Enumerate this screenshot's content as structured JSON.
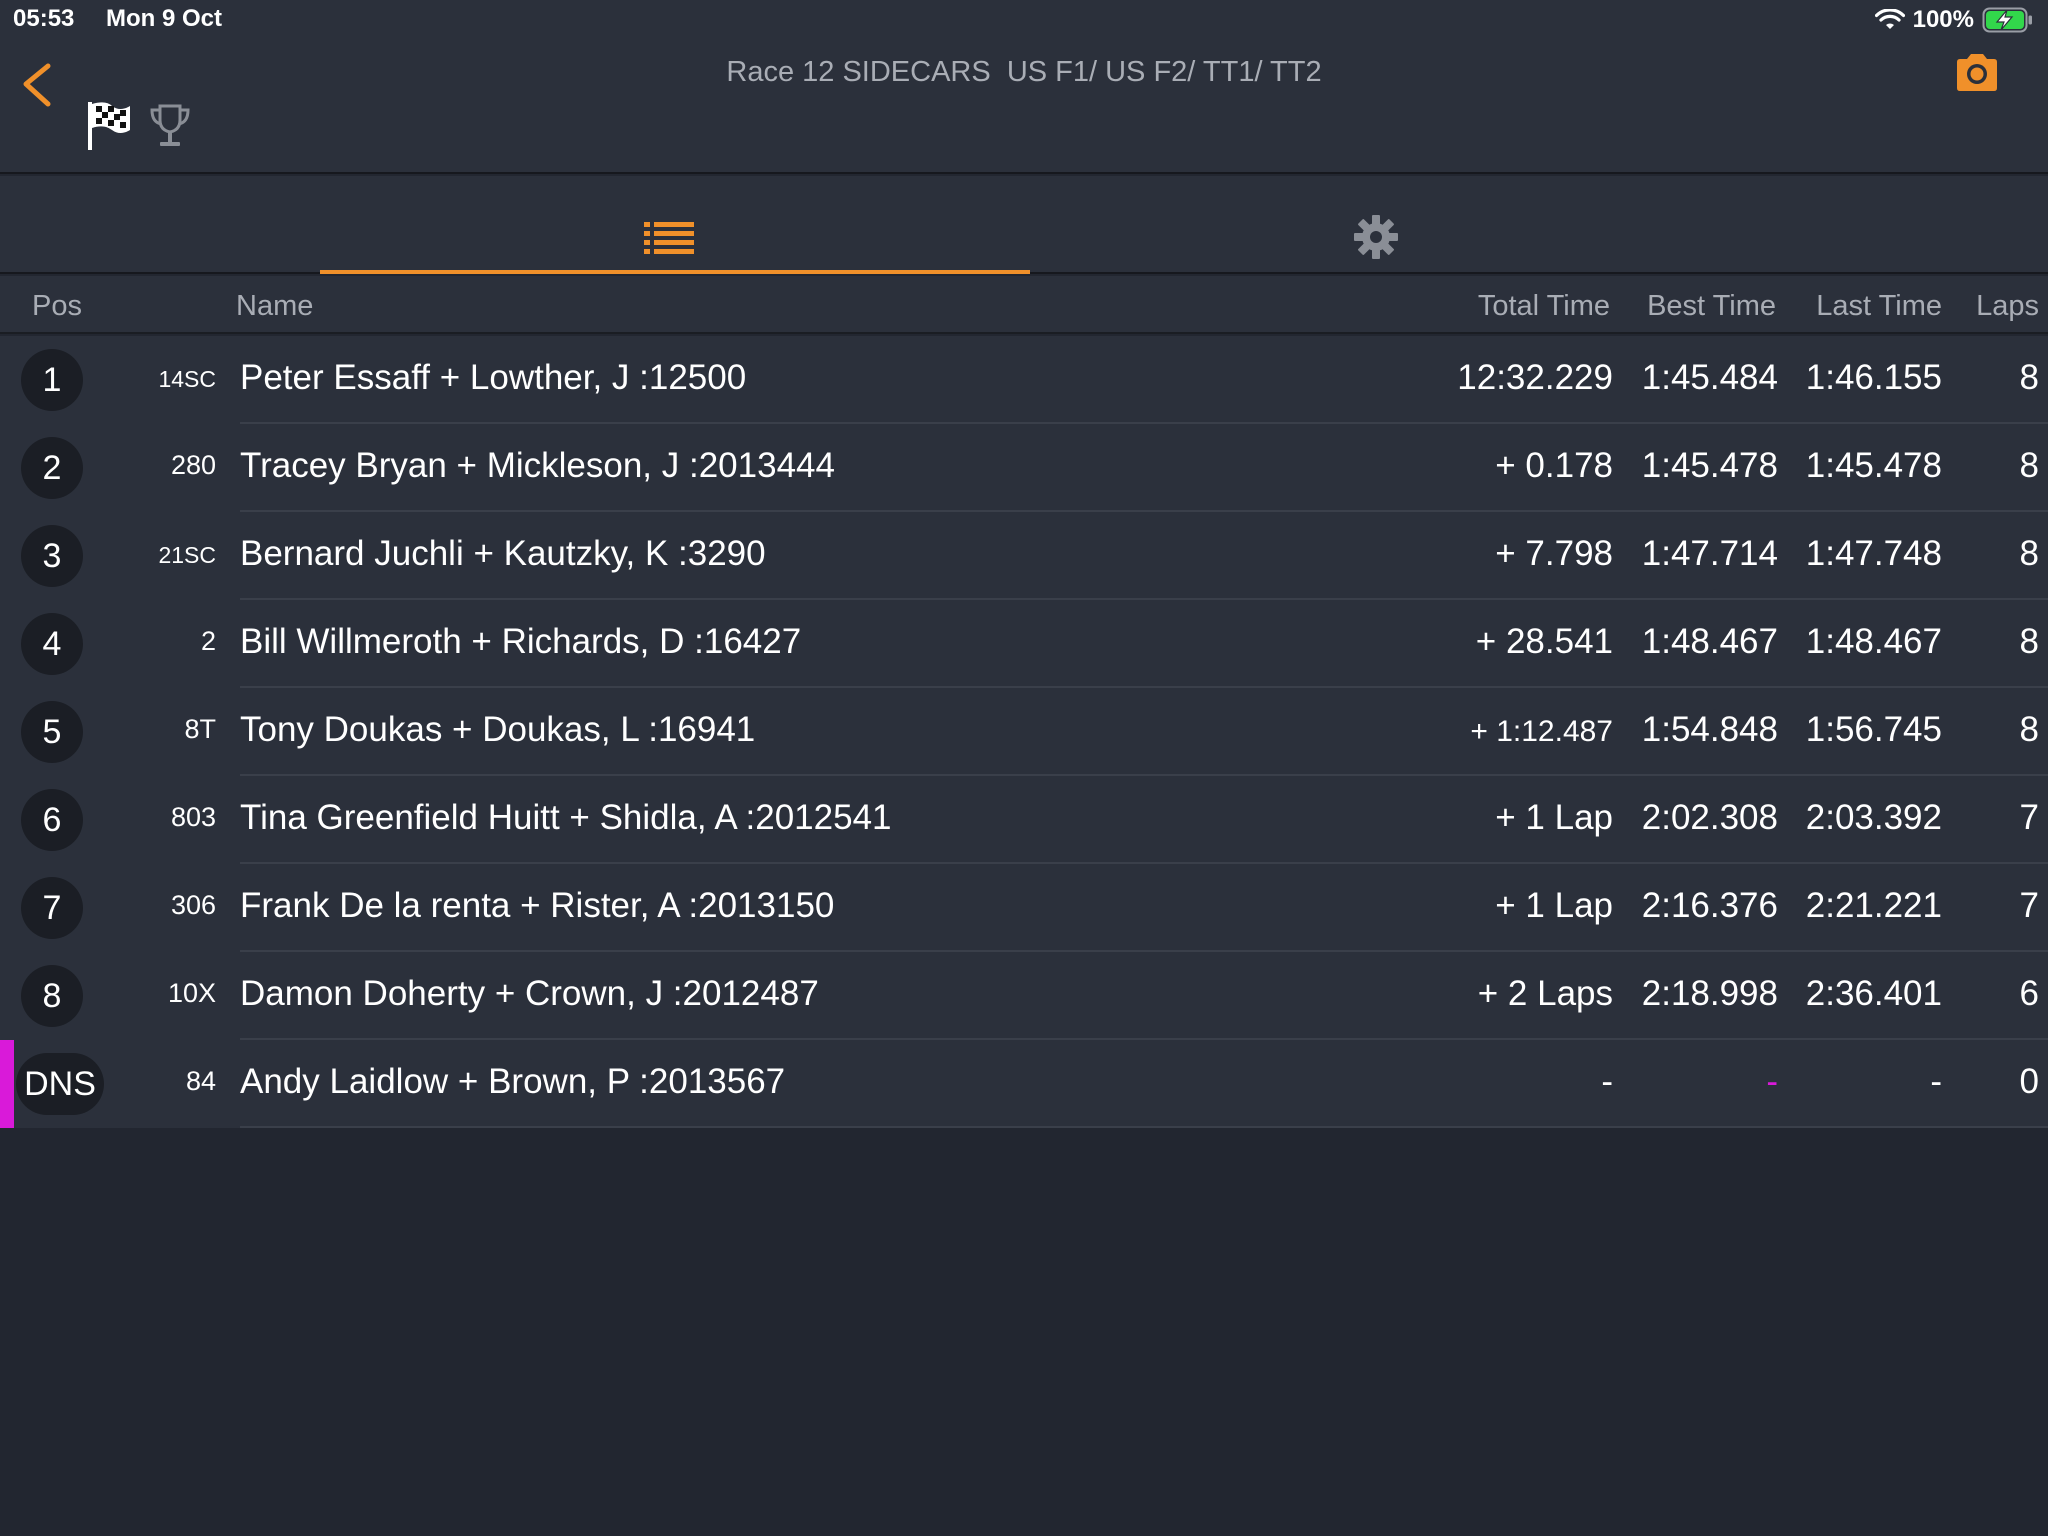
{
  "status_bar": {
    "time": "05:53",
    "date": "Mon 9 Oct",
    "battery": "100%",
    "icons": [
      "wifi-icon",
      "battery-charging-icon"
    ]
  },
  "header": {
    "title": "Race 12 SIDECARS  US F1/ US F2/ TT1/ TT2",
    "icons": [
      "back-chevron-icon",
      "checkered-flag-icon",
      "trophy-icon",
      "camera-icon"
    ],
    "accent_color": "#f0902a"
  },
  "tabs": [
    {
      "icon": "list-icon",
      "active": true
    },
    {
      "icon": "gear-icon",
      "active": false
    }
  ],
  "columns": {
    "pos": "Pos",
    "name": "Name",
    "total": "Total Time",
    "best": "Best Time",
    "last": "Last Time",
    "laps": "Laps"
  },
  "rows": [
    {
      "pos": "1",
      "num": "14SC",
      "name": "Peter Essaff + Lowther, J :12500",
      "total": "12:32.229",
      "best": "1:45.484",
      "last": "1:46.155",
      "laps": "8"
    },
    {
      "pos": "2",
      "num": "280",
      "name": "Tracey Bryan + Mickleson, J :2013444",
      "total": "+ 0.178",
      "best": "1:45.478",
      "last": "1:45.478",
      "laps": "8"
    },
    {
      "pos": "3",
      "num": "21SC",
      "name": "Bernard Juchli + Kautzky, K :3290",
      "total": "+ 7.798",
      "best": "1:47.714",
      "last": "1:47.748",
      "laps": "8"
    },
    {
      "pos": "4",
      "num": "2",
      "name": "Bill Willmeroth + Richards, D :16427",
      "total": "+ 28.541",
      "best": "1:48.467",
      "last": "1:48.467",
      "laps": "8"
    },
    {
      "pos": "5",
      "num": "8T",
      "name": "Tony Doukas + Doukas, L :16941",
      "total": "+ 1:12.487",
      "best": "1:54.848",
      "last": "1:56.745",
      "laps": "8"
    },
    {
      "pos": "6",
      "num": "803",
      "name": "Tina Greenfield Huitt + Shidla, A :2012541",
      "total": "+ 1 Lap",
      "best": "2:02.308",
      "last": "2:03.392",
      "laps": "7"
    },
    {
      "pos": "7",
      "num": "306",
      "name": "Frank De la renta + Rister, A :2013150",
      "total": "+ 1 Lap",
      "best": "2:16.376",
      "last": "2:21.221",
      "laps": "7"
    },
    {
      "pos": "8",
      "num": "10X",
      "name": "Damon Doherty + Crown, J :2012487",
      "total": "+ 2 Laps",
      "best": "2:18.998",
      "last": "2:36.401",
      "laps": "6"
    },
    {
      "pos": "DNS",
      "num": "84",
      "name": "Andy Laidlow + Brown, P :2013567",
      "total": "-",
      "best": "-",
      "last": "-",
      "laps": "0"
    }
  ],
  "colors": {
    "dns_marker": "#d91ad9"
  }
}
